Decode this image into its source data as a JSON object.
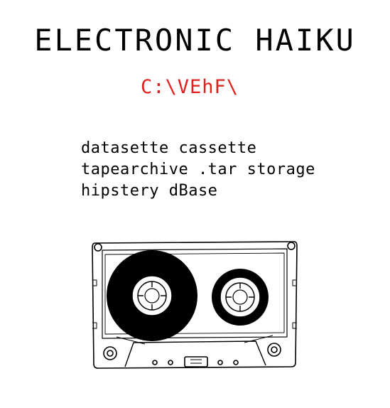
{
  "page": {
    "title": "ELECTRONIC HAIKU",
    "path": "C:\\VEhF\\",
    "lines": [
      "datasette cassette",
      "tapearchive .tar storage",
      "hipstery dBase"
    ]
  },
  "colors": {
    "text": "#000000",
    "path": "#e0201c",
    "background": "#ffffff"
  },
  "illustration": {
    "icon": "cassette-tape-icon"
  }
}
